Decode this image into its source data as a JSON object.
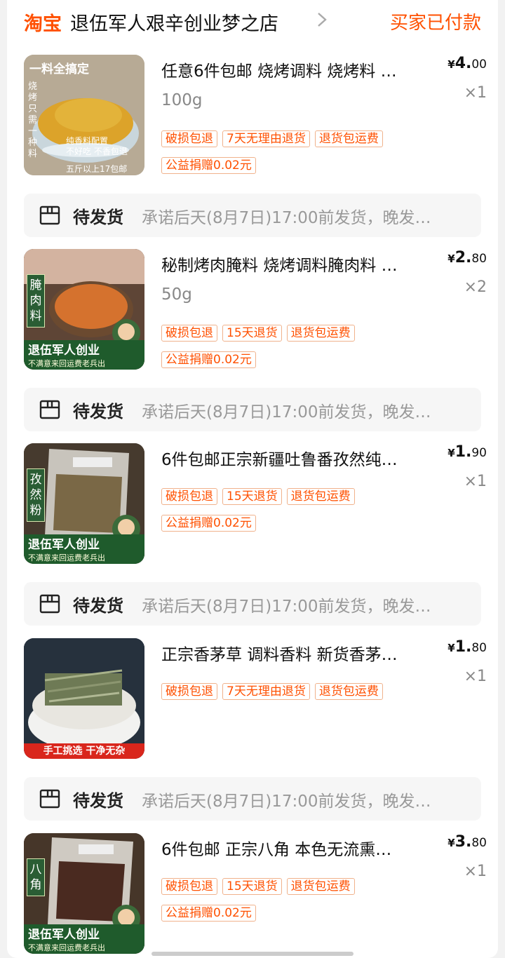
{
  "header": {
    "brand": "淘宝",
    "shop_name": "退伍军人艰辛创业梦之店",
    "order_status": "买家已付款"
  },
  "shipping": {
    "label": "待发货",
    "note": "承诺后天(8月7日)17:00前发货，晚发…"
  },
  "items": [
    {
      "title": "任意6件包邮 烧烤调料 烧烤料 …",
      "sku": "100g",
      "price_currency": "¥",
      "price_int": "4.",
      "price_dec": "00",
      "qty": "×1",
      "tags": [
        "破损包退",
        "7天无理由退货",
        "退货包运费"
      ],
      "charity": "公益捐赠0.02元",
      "image": {
        "top_text": "一料全搞定",
        "side_text": "烧烤只需一种料",
        "middle_text": "纯香料配置\n不好吃 不香包退",
        "bottom_text": "五斤以上17包邮"
      }
    },
    {
      "title": "秘制烤肉腌料 烧烤调料腌肉料 …",
      "sku": "50g",
      "price_currency": "¥",
      "price_int": "2.",
      "price_dec": "80",
      "qty": "×2",
      "tags": [
        "破损包退",
        "15天退货",
        "退货包运费"
      ],
      "charity": "公益捐赠0.02元",
      "image": {
        "vertical_text": "腌肉料",
        "band_main": "退伍军人创业",
        "band_sub": "不满意来回运费老兵出"
      }
    },
    {
      "title": "6件包邮正宗新疆吐鲁番孜然纯…",
      "sku": "",
      "price_currency": "¥",
      "price_int": "1.",
      "price_dec": "90",
      "qty": "×1",
      "tags": [
        "破损包退",
        "15天退货",
        "退货包运费"
      ],
      "charity": "公益捐赠0.02元",
      "image": {
        "vertical_text": "孜然粉",
        "band_main": "退伍军人创业",
        "band_sub": "不满意来回运费老兵出"
      }
    },
    {
      "title": "正宗香茅草 调料香料 新货香茅…",
      "sku": "",
      "price_currency": "¥",
      "price_int": "1.",
      "price_dec": "80",
      "qty": "×1",
      "tags": [
        "破损包退",
        "7天无理由退货",
        "退货包运费"
      ],
      "charity": "",
      "image": {
        "band_main": "手工挑选 干净无杂"
      }
    },
    {
      "title": "6件包邮 正宗八角 本色无流熏…",
      "sku": "",
      "price_currency": "¥",
      "price_int": "3.",
      "price_dec": "80",
      "qty": "×1",
      "tags": [
        "破损包退",
        "15天退货",
        "退货包运费"
      ],
      "charity": "公益捐赠0.02元",
      "image": {
        "vertical_text": "八角",
        "band_main": "退伍军人创业",
        "band_sub": "不满意来回运费老兵出"
      }
    }
  ],
  "colors": {
    "accent": "#ff5000",
    "tag_border": "#f0b28c",
    "ship_bg": "#f6f6f6"
  },
  "icons": {
    "chevron": "chevron-right-icon",
    "box": "package-box-icon"
  }
}
